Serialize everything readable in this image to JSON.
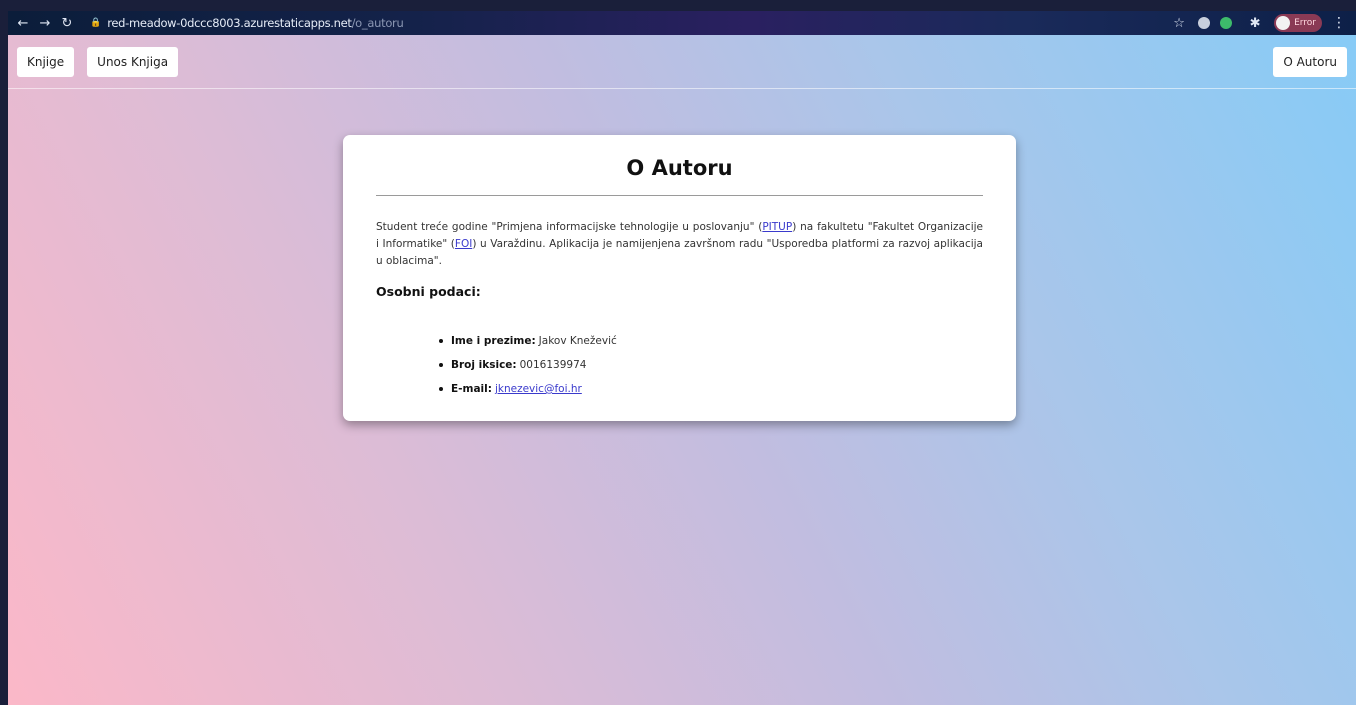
{
  "browser": {
    "url_host": "red-meadow-0dccc8003.azurestaticapps.net",
    "url_path": "/o_autoru",
    "profile_status": "Error"
  },
  "nav": {
    "books": "Knjige",
    "add_book": "Unos Knjiga",
    "about": "O Autoru"
  },
  "card": {
    "title": "O Autoru",
    "intro": {
      "p1": "Student treće godine \"Primjena informacijske tehnologije u poslovanju\" (",
      "pitup": "PITUP",
      "p2": ") na fakultetu \"Fakultet Organizacije i Informatike\" (",
      "foi": "FOI",
      "p3": ") u Varaždinu. Aplikacija je namijenjena završnom radu \"Usporedba platformi za razvoj aplikacija u oblacima\"."
    },
    "section_title": "Osobni podaci:",
    "details": {
      "name_label": "Ime i prezime:",
      "name_value": "Jakov Knežević",
      "id_label": "Broj iksice:",
      "id_value": "0016139974",
      "email_label": "E-mail:",
      "email_value": "jknezevic@foi.hr"
    }
  },
  "colors": {
    "accent_link": "#3a3acc",
    "bg_gradient_start": "#fbb8c8",
    "bg_gradient_end": "#87cbf6"
  }
}
